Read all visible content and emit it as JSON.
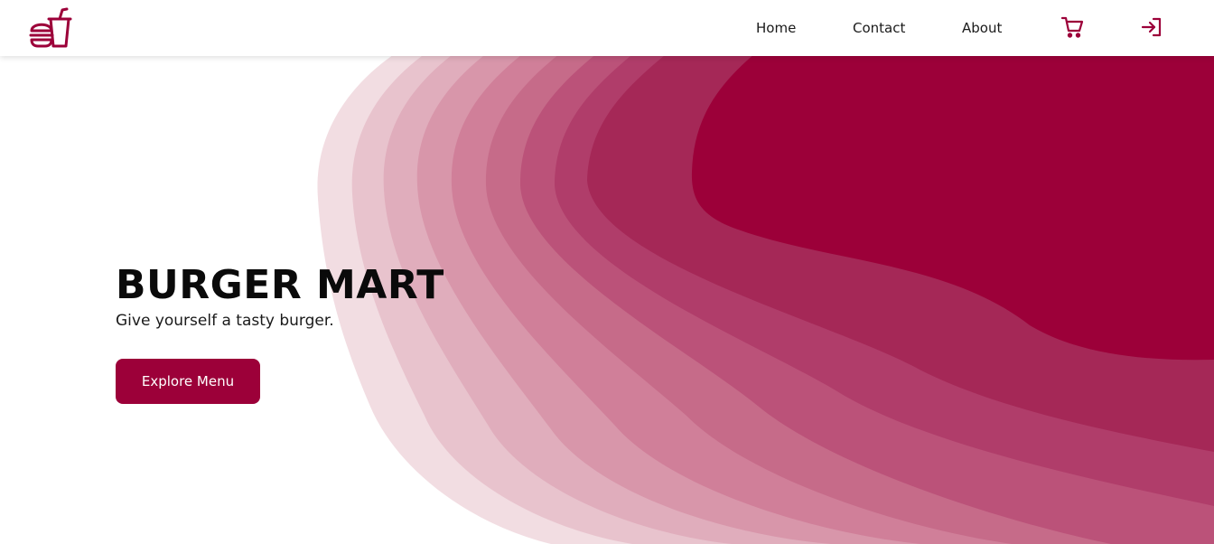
{
  "brand": {
    "logo_icon": "fast-food-burger-drink-icon",
    "accent_color": "#9c0039"
  },
  "nav": {
    "links": [
      {
        "label": "Home"
      },
      {
        "label": "Contact"
      },
      {
        "label": "About"
      }
    ],
    "cart_icon": "shopping-cart-icon",
    "login_icon": "login-arrow-icon"
  },
  "hero": {
    "title": "BURGER MART",
    "subtitle": "Give yourself a tasty burger.",
    "cta_label": "Explore Menu",
    "wave_colors": [
      "#f2dde2",
      "#e8c3cd",
      "#e0adbc",
      "#d896aa",
      "#d07f99",
      "#c66b89",
      "#bb5279",
      "#b03d6a",
      "#a52857",
      "#9c0039"
    ]
  }
}
